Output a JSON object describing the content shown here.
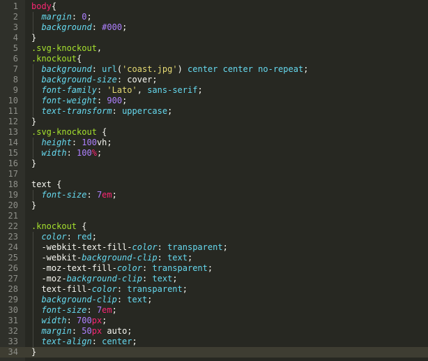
{
  "editor": {
    "language": "CSS",
    "current_line": 34,
    "lines": [
      {
        "n": "1",
        "tokens": [
          [
            "tok-sel",
            "body"
          ],
          [
            "tok-punc",
            "{"
          ]
        ]
      },
      {
        "n": "2",
        "tokens": [
          [
            "tok-plain",
            "  "
          ],
          [
            "tok-prop",
            "margin"
          ],
          [
            "tok-punc",
            ": "
          ],
          [
            "tok-num",
            "0"
          ],
          [
            "tok-punc",
            ";"
          ]
        ]
      },
      {
        "n": "3",
        "tokens": [
          [
            "tok-plain",
            "  "
          ],
          [
            "tok-prop",
            "background"
          ],
          [
            "tok-punc",
            ": "
          ],
          [
            "tok-num",
            "#000"
          ],
          [
            "tok-punc",
            ";"
          ]
        ]
      },
      {
        "n": "4",
        "tokens": [
          [
            "tok-punc",
            "}"
          ]
        ]
      },
      {
        "n": "5",
        "tokens": [
          [
            "tok-cls",
            ".svg-knockout"
          ],
          [
            "tok-punc",
            ","
          ]
        ]
      },
      {
        "n": "6",
        "tokens": [
          [
            "tok-cls",
            ".knockout"
          ],
          [
            "tok-punc",
            "{"
          ]
        ]
      },
      {
        "n": "7",
        "tokens": [
          [
            "tok-plain",
            "  "
          ],
          [
            "tok-prop",
            "background"
          ],
          [
            "tok-punc",
            ": "
          ],
          [
            "tok-kw",
            "url"
          ],
          [
            "tok-punc",
            "("
          ],
          [
            "tok-str",
            "'coast.jpg'"
          ],
          [
            "tok-punc",
            ") "
          ],
          [
            "tok-kw",
            "center center no-repeat"
          ],
          [
            "tok-punc",
            ";"
          ]
        ]
      },
      {
        "n": "8",
        "tokens": [
          [
            "tok-plain",
            "  "
          ],
          [
            "tok-prop",
            "background-size"
          ],
          [
            "tok-punc",
            ": "
          ],
          [
            "tok-plain",
            "cover"
          ],
          [
            "tok-punc",
            ";"
          ]
        ]
      },
      {
        "n": "9",
        "tokens": [
          [
            "tok-plain",
            "  "
          ],
          [
            "tok-prop",
            "font-family"
          ],
          [
            "tok-punc",
            ": "
          ],
          [
            "tok-str",
            "'Lato'"
          ],
          [
            "tok-punc",
            ", "
          ],
          [
            "tok-kw",
            "sans-serif"
          ],
          [
            "tok-punc",
            ";"
          ]
        ]
      },
      {
        "n": "10",
        "tokens": [
          [
            "tok-plain",
            "  "
          ],
          [
            "tok-prop",
            "font-weight"
          ],
          [
            "tok-punc",
            ": "
          ],
          [
            "tok-num",
            "900"
          ],
          [
            "tok-punc",
            ";"
          ]
        ]
      },
      {
        "n": "11",
        "tokens": [
          [
            "tok-plain",
            "  "
          ],
          [
            "tok-prop",
            "text-transform"
          ],
          [
            "tok-punc",
            ": "
          ],
          [
            "tok-kw",
            "uppercase"
          ],
          [
            "tok-punc",
            ";"
          ]
        ]
      },
      {
        "n": "12",
        "tokens": [
          [
            "tok-punc",
            "}"
          ]
        ]
      },
      {
        "n": "13",
        "tokens": [
          [
            "tok-cls",
            ".svg-knockout"
          ],
          [
            "tok-punc",
            " {"
          ]
        ]
      },
      {
        "n": "14",
        "tokens": [
          [
            "tok-plain",
            "  "
          ],
          [
            "tok-prop",
            "height"
          ],
          [
            "tok-punc",
            ": "
          ],
          [
            "tok-num",
            "100"
          ],
          [
            "tok-plain",
            "vh"
          ],
          [
            "tok-punc",
            ";"
          ]
        ]
      },
      {
        "n": "15",
        "tokens": [
          [
            "tok-plain",
            "  "
          ],
          [
            "tok-prop",
            "width"
          ],
          [
            "tok-punc",
            ": "
          ],
          [
            "tok-num",
            "100"
          ],
          [
            "tok-unit",
            "%"
          ],
          [
            "tok-punc",
            ";"
          ]
        ]
      },
      {
        "n": "16",
        "tokens": [
          [
            "tok-punc",
            "}"
          ]
        ]
      },
      {
        "n": "17",
        "tokens": []
      },
      {
        "n": "18",
        "tokens": [
          [
            "tok-plain",
            "text"
          ],
          [
            "tok-punc",
            " {"
          ]
        ]
      },
      {
        "n": "19",
        "tokens": [
          [
            "tok-plain",
            "  "
          ],
          [
            "tok-prop",
            "font-size"
          ],
          [
            "tok-punc",
            ": "
          ],
          [
            "tok-num",
            "7"
          ],
          [
            "tok-unit",
            "em"
          ],
          [
            "tok-punc",
            ";"
          ]
        ]
      },
      {
        "n": "20",
        "tokens": [
          [
            "tok-punc",
            "}"
          ]
        ]
      },
      {
        "n": "21",
        "tokens": []
      },
      {
        "n": "22",
        "tokens": [
          [
            "tok-cls",
            ".knockout"
          ],
          [
            "tok-punc",
            " {"
          ]
        ]
      },
      {
        "n": "23",
        "tokens": [
          [
            "tok-plain",
            "  "
          ],
          [
            "tok-prop",
            "color"
          ],
          [
            "tok-punc",
            ": "
          ],
          [
            "tok-kw",
            "red"
          ],
          [
            "tok-punc",
            ";"
          ]
        ]
      },
      {
        "n": "24",
        "tokens": [
          [
            "tok-plain",
            "  "
          ],
          [
            "tok-propn",
            "-webkit-text-fill-"
          ],
          [
            "tok-prop",
            "color"
          ],
          [
            "tok-punc",
            ": "
          ],
          [
            "tok-kw",
            "transparent"
          ],
          [
            "tok-punc",
            ";"
          ]
        ]
      },
      {
        "n": "25",
        "tokens": [
          [
            "tok-plain",
            "  "
          ],
          [
            "tok-propn",
            "-webkit-"
          ],
          [
            "tok-prop",
            "background-clip"
          ],
          [
            "tok-punc",
            ": "
          ],
          [
            "tok-kw",
            "text"
          ],
          [
            "tok-punc",
            ";"
          ]
        ]
      },
      {
        "n": "26",
        "tokens": [
          [
            "tok-plain",
            "  "
          ],
          [
            "tok-propn",
            "-moz-text-fill-"
          ],
          [
            "tok-prop",
            "color"
          ],
          [
            "tok-punc",
            ": "
          ],
          [
            "tok-kw",
            "transparent"
          ],
          [
            "tok-punc",
            ";"
          ]
        ]
      },
      {
        "n": "27",
        "tokens": [
          [
            "tok-plain",
            "  "
          ],
          [
            "tok-propn",
            "-moz-"
          ],
          [
            "tok-prop",
            "background-clip"
          ],
          [
            "tok-punc",
            ": "
          ],
          [
            "tok-kw",
            "text"
          ],
          [
            "tok-punc",
            ";"
          ]
        ]
      },
      {
        "n": "28",
        "tokens": [
          [
            "tok-plain",
            "  "
          ],
          [
            "tok-propn",
            "text-fill-"
          ],
          [
            "tok-prop",
            "color"
          ],
          [
            "tok-punc",
            ": "
          ],
          [
            "tok-kw",
            "transparent"
          ],
          [
            "tok-punc",
            ";"
          ]
        ]
      },
      {
        "n": "29",
        "tokens": [
          [
            "tok-plain",
            "  "
          ],
          [
            "tok-prop",
            "background-clip"
          ],
          [
            "tok-punc",
            ": "
          ],
          [
            "tok-kw",
            "text"
          ],
          [
            "tok-punc",
            ";"
          ]
        ]
      },
      {
        "n": "30",
        "tokens": [
          [
            "tok-plain",
            "  "
          ],
          [
            "tok-prop",
            "font-size"
          ],
          [
            "tok-punc",
            ": "
          ],
          [
            "tok-num",
            "7"
          ],
          [
            "tok-unit",
            "em"
          ],
          [
            "tok-punc",
            ";"
          ]
        ]
      },
      {
        "n": "31",
        "tokens": [
          [
            "tok-plain",
            "  "
          ],
          [
            "tok-prop",
            "width"
          ],
          [
            "tok-punc",
            ": "
          ],
          [
            "tok-num",
            "700"
          ],
          [
            "tok-unit",
            "px"
          ],
          [
            "tok-punc",
            ";"
          ]
        ]
      },
      {
        "n": "32",
        "tokens": [
          [
            "tok-plain",
            "  "
          ],
          [
            "tok-prop",
            "margin"
          ],
          [
            "tok-punc",
            ": "
          ],
          [
            "tok-num",
            "50"
          ],
          [
            "tok-unit",
            "px"
          ],
          [
            "tok-plain",
            " auto"
          ],
          [
            "tok-punc",
            ";"
          ]
        ]
      },
      {
        "n": "33",
        "tokens": [
          [
            "tok-plain",
            "  "
          ],
          [
            "tok-prop",
            "text-align"
          ],
          [
            "tok-punc",
            ": "
          ],
          [
            "tok-kw",
            "center"
          ],
          [
            "tok-punc",
            ";"
          ]
        ]
      },
      {
        "n": "34",
        "tokens": [
          [
            "tok-punc",
            "}"
          ]
        ]
      }
    ]
  }
}
